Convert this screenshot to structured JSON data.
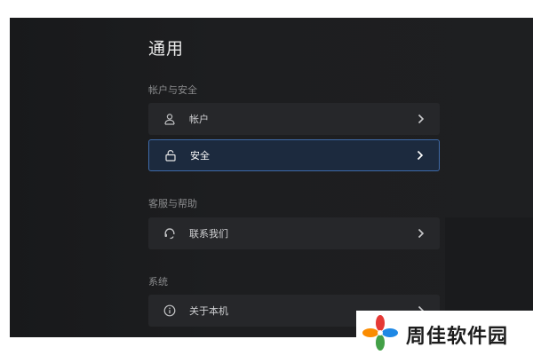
{
  "page": {
    "title": "通用"
  },
  "sections": [
    {
      "label": "帐户与安全",
      "items": [
        {
          "label": "帐户",
          "icon": "user-icon"
        },
        {
          "label": "安全",
          "icon": "lock-icon",
          "selected": true
        }
      ]
    },
    {
      "label": "客服与帮助",
      "items": [
        {
          "label": "联系我们",
          "icon": "headset-icon"
        }
      ]
    },
    {
      "label": "系统",
      "items": [
        {
          "label": "关于本机",
          "icon": "info-icon"
        }
      ]
    }
  ],
  "watermark": {
    "text": "周佳软件园"
  },
  "colors": {
    "background": "#1e1f21",
    "row": "#26272a",
    "selected_row": "#1c2a3e",
    "selected_border": "#3e6aa8"
  }
}
